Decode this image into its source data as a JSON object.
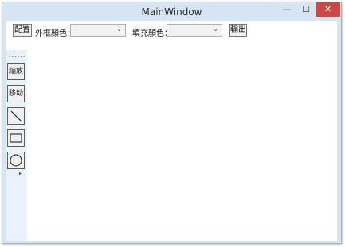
{
  "window": {
    "title": "MainWindow",
    "min_glyph": "—",
    "max_glyph": "☐",
    "close_glyph": "✕"
  },
  "toolbar": {
    "config_label": "配置",
    "stroke_label": "外框顏色：",
    "stroke_value": "",
    "fill_label": "填充顏色：",
    "fill_value": "",
    "export_label": "輸出"
  },
  "left_toolbar": {
    "grip": "......",
    "scale_label": "縮放",
    "move_label": "移动",
    "tools": [
      "line-icon",
      "rectangle-icon",
      "circle-icon"
    ],
    "overflow_glyph": "▸"
  }
}
